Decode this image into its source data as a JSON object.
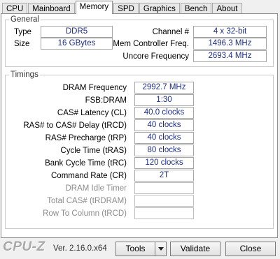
{
  "tabs": [
    "CPU",
    "Mainboard",
    "Memory",
    "SPD",
    "Graphics",
    "Bench",
    "About"
  ],
  "general": {
    "title": "General",
    "type_label": "Type",
    "type_value": "DDR5",
    "size_label": "Size",
    "size_value": "16 GBytes",
    "channel_label": "Channel #",
    "channel_value": "4 x 32-bit",
    "memctrl_label": "Mem Controller Freq.",
    "memctrl_value": "1496.3 MHz",
    "uncore_label": "Uncore Frequency",
    "uncore_value": "2693.4 MHz"
  },
  "timings": {
    "title": "Timings",
    "rows": [
      {
        "label": "DRAM Frequency",
        "value": "2992.7 MHz"
      },
      {
        "label": "FSB:DRAM",
        "value": "1:30"
      },
      {
        "label": "CAS# Latency (CL)",
        "value": "40.0 clocks"
      },
      {
        "label": "RAS# to CAS# Delay (tRCD)",
        "value": "40 clocks"
      },
      {
        "label": "RAS# Precharge (tRP)",
        "value": "40 clocks"
      },
      {
        "label": "Cycle Time (tRAS)",
        "value": "80 clocks"
      },
      {
        "label": "Bank Cycle Time (tRC)",
        "value": "120 clocks"
      },
      {
        "label": "Command Rate (CR)",
        "value": "2T"
      },
      {
        "label": "DRAM Idle Timer",
        "value": ""
      },
      {
        "label": "Total CAS# (tRDRAM)",
        "value": ""
      },
      {
        "label": "Row To Column (tRCD)",
        "value": ""
      }
    ]
  },
  "footer": {
    "logo": "CPU-Z",
    "version": "Ver. 2.16.0.x64",
    "tools_label": "Tools",
    "validate_label": "Validate",
    "close_label": "Close"
  }
}
